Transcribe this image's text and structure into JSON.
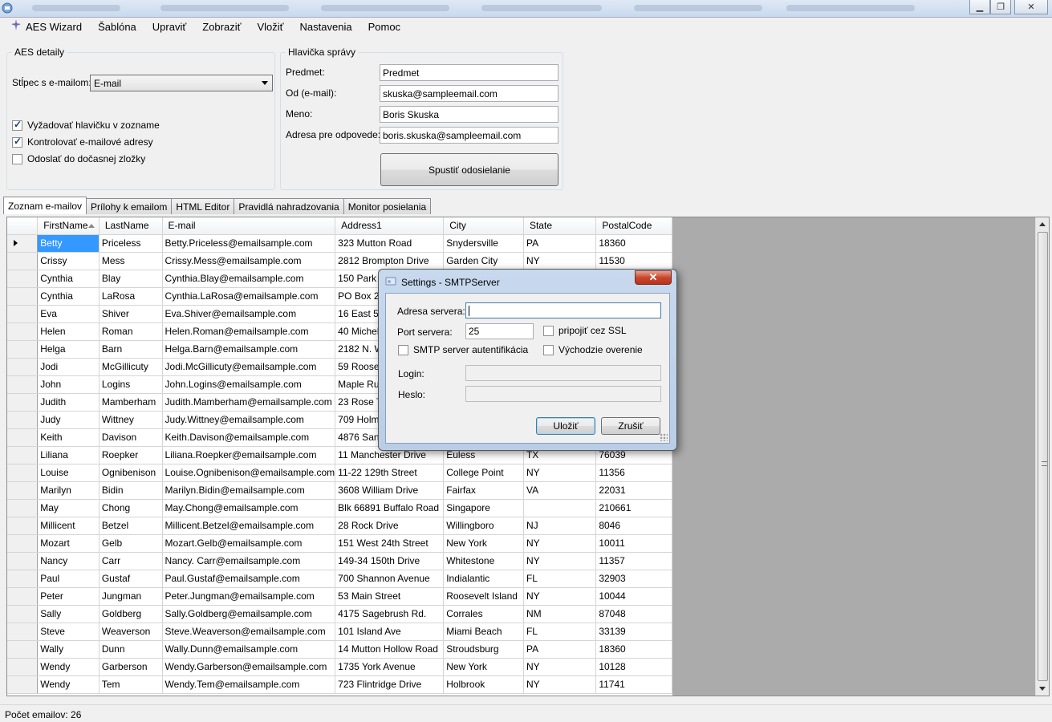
{
  "menubar": {
    "items": [
      "AES Wizard",
      "Šablóna",
      "Upraviť",
      "Zobraziť",
      "Vložiť",
      "Nastavenia",
      "Pomoc"
    ]
  },
  "aes_details": {
    "title": "AES detaily",
    "email_column_label": "Stĺpec s e-mailom:",
    "email_column_value": "E-mail",
    "checkboxes": [
      {
        "label": "Vyžadovať hlavičku v zozname",
        "checked": true
      },
      {
        "label": "Kontrolovať e-mailové adresy",
        "checked": true
      },
      {
        "label": "Odoslať do dočasnej zložky",
        "checked": false
      }
    ]
  },
  "message_header": {
    "title": "Hlavička správy",
    "fields": [
      {
        "label": "Predmet:",
        "value": "Predmet"
      },
      {
        "label": "Od (e-mail):",
        "value": "skuska@sampleemail.com"
      },
      {
        "label": "Meno:",
        "value": "Boris Skuska"
      },
      {
        "label": "Adresa pre odpovede:",
        "value": "boris.skuska@sampleemail.com"
      }
    ],
    "start_button": "Spustiť odosielanie"
  },
  "tabs": [
    "Zoznam e-mailov",
    "Prílohy k emailom",
    "HTML Editor",
    "Pravidlá nahradzovania",
    "Monitor posielania"
  ],
  "grid": {
    "columns": [
      "FirstName",
      "LastName",
      "E-mail",
      "Address1",
      "City",
      "State",
      "PostalCode"
    ],
    "rows": [
      [
        "Betty",
        "Priceless",
        "Betty.Priceless@emailsample.com",
        "323 Mutton  Road",
        "Snydersville",
        "PA",
        "18360"
      ],
      [
        "Crissy",
        "Mess",
        "Crissy.Mess@emailsample.com",
        "2812 Brompton Drive",
        "Garden City",
        "NY",
        "11530"
      ],
      [
        "Cynthia",
        "Blay",
        "Cynthia.Blay@emailsample.com",
        "150  Park We",
        "",
        "",
        ""
      ],
      [
        "Cynthia",
        "LaRosa",
        "Cynthia.LaRosa@emailsample.com",
        "PO Box 223",
        "",
        "",
        ""
      ],
      [
        "Eva",
        "Shiver",
        "Eva.Shiver@emailsample.com",
        "16 East 564th",
        "",
        "",
        ""
      ],
      [
        "Helen",
        "Roman",
        "Helen.Roman@emailsample.com",
        "40 Michele La",
        "",
        "",
        ""
      ],
      [
        "Helga",
        "Barn",
        "Helga.Barn@emailsample.com",
        "2182 N.  Way",
        "",
        "",
        ""
      ],
      [
        "Jodi",
        "McGillicuty",
        "Jodi.McGillicuty@emailsample.com",
        "59 Roosevelt",
        "",
        "",
        ""
      ],
      [
        "John",
        "Logins",
        "John.Logins@emailsample.com",
        "Maple Run Ma",
        "",
        "",
        ""
      ],
      [
        "Judith",
        "Mamberham",
        "Judith.Mamberham@emailsample.com",
        "23 Rose Tree",
        "",
        "",
        ""
      ],
      [
        "Judy",
        "Wittney",
        "Judy.Wittney@emailsample.com",
        "709 Holmes R",
        "",
        "",
        ""
      ],
      [
        "Keith",
        "Davison",
        "Keith.Davison@emailsample.com",
        "4876 San Mar",
        "",
        "",
        ""
      ],
      [
        "Liliana",
        "Roepker",
        "Liliana.Roepker@emailsample.com",
        "11 Manchester Drive",
        "Euless",
        "TX",
        "76039"
      ],
      [
        "Louise",
        "Ognibenison",
        "Louise.Ognibenison@emailsample.com",
        "11-22 129th Street",
        "College Point",
        "NY",
        "11356"
      ],
      [
        "Marilyn",
        "Bidin",
        "Marilyn.Bidin@emailsample.com",
        "3608  William Drive",
        "Fairfax",
        "VA",
        "22031"
      ],
      [
        "May",
        "Chong",
        "May.Chong@emailsample.com",
        "Blk 66891 Buffalo Road",
        "Singapore",
        "",
        "210661"
      ],
      [
        "Millicent",
        "Betzel",
        "Millicent.Betzel@emailsample.com",
        "28 Rock Drive",
        "Willingboro",
        "NJ",
        "8046"
      ],
      [
        "Mozart",
        "Gelb",
        "Mozart.Gelb@emailsample.com",
        "151 West 24th Street",
        "New York",
        "NY",
        "10011"
      ],
      [
        "Nancy",
        " Carr",
        "Nancy. Carr@emailsample.com",
        "149-34 150th Drive",
        "Whitestone",
        "NY",
        "11357"
      ],
      [
        "Paul",
        "Gustaf",
        "Paul.Gustaf@emailsample.com",
        "700  Shannon Avenue",
        "Indialantic",
        "FL",
        "32903"
      ],
      [
        "Peter",
        "Jungman",
        "Peter.Jungman@emailsample.com",
        "53 Main Street",
        "Roosevelt Island",
        "NY",
        "10044"
      ],
      [
        "Sally",
        "Goldberg",
        "Sally.Goldberg@emailsample.com",
        "4175 Sagebrush Rd.",
        "Corrales",
        "NM",
        "87048"
      ],
      [
        "Steve",
        "Weaverson",
        "Steve.Weaverson@emailsample.com",
        "101 Island Ave",
        "Miami Beach",
        "FL",
        "33139"
      ],
      [
        "Wally",
        "Dunn",
        "Wally.Dunn@emailsample.com",
        "14 Mutton Hollow Road",
        "Stroudsburg",
        "PA",
        "18360"
      ],
      [
        "Wendy",
        "Garberson",
        "Wendy.Garberson@emailsample.com",
        "1735 York Avenue",
        "New York",
        "NY",
        "10128"
      ],
      [
        "Wendy",
        "Tem",
        "Wendy.Tem@emailsample.com",
        "723 Flintridge Drive",
        "Holbrook",
        "NY",
        "11741"
      ]
    ]
  },
  "status": {
    "text": "Počet emailov: 26"
  },
  "dialog": {
    "title": "Settings - SMTPServer",
    "close_glyph": "✕",
    "server_label": "Adresa servera:",
    "server_value": "",
    "port_label": "Port servera:",
    "port_value": "25",
    "ssl_label": "pripojiť cez SSL",
    "ssl_checked": false,
    "auth_label": "SMTP server autentifikácia",
    "auth_checked": false,
    "default_auth_label": "Východzie overenie",
    "default_auth_checked": false,
    "login_label": "Login:",
    "password_label": "Heslo:",
    "save_button": "Uložiť",
    "cancel_button": "Zrušiť"
  },
  "colors": {
    "selection": "#3399ff",
    "grid_background": "#ababab",
    "dialog_frame": "#c8d9ee",
    "close_button": "#c9462c"
  }
}
